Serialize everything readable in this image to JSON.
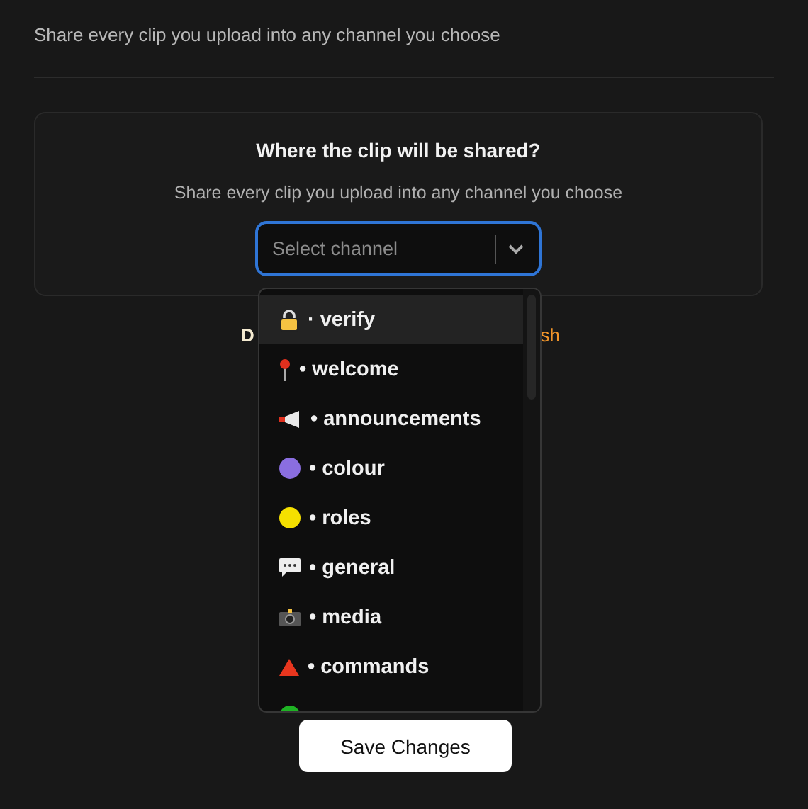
{
  "header": {
    "description": "Share every clip you upload into any channel you choose"
  },
  "card": {
    "title": "Where the clip will be shared?",
    "subtitle": "Share every clip you upload into any channel you choose",
    "select": {
      "placeholder": "Select channel",
      "expanded": true
    }
  },
  "hidden_note": {
    "start": "D",
    "end": "sh"
  },
  "dropdown": {
    "items": [
      {
        "kind": "lock",
        "label": "· verify",
        "selected": true
      },
      {
        "kind": "pin",
        "label": "• welcome",
        "selected": false
      },
      {
        "kind": "megaphone",
        "label": "• announcements",
        "selected": false
      },
      {
        "kind": "circle",
        "color": "#8a6ee0",
        "label": "• colour",
        "selected": false
      },
      {
        "kind": "circle",
        "color": "#f5e000",
        "label": "• roles",
        "selected": false
      },
      {
        "kind": "speech",
        "label": "• general",
        "selected": false
      },
      {
        "kind": "camera",
        "label": "• media",
        "selected": false
      },
      {
        "kind": "triangle",
        "label": "• commands",
        "selected": false
      },
      {
        "kind": "circle",
        "color": "#1fb324",
        "selected": false
      }
    ]
  },
  "save_button": "Save Changes"
}
